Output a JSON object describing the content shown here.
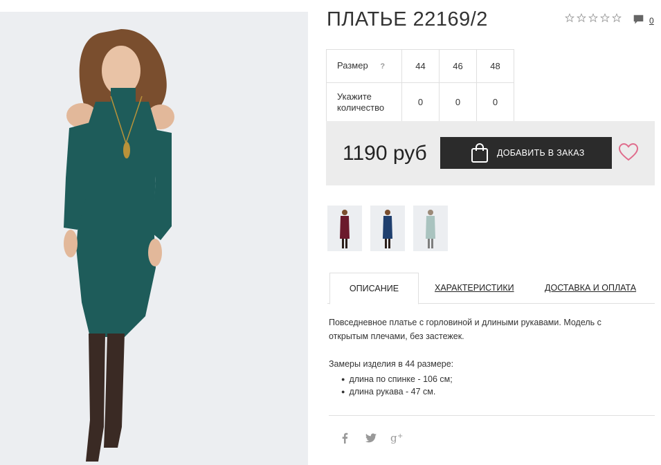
{
  "product": {
    "title": "ПЛАТЬЕ 22169/2",
    "rating_stars": 5,
    "rating_value": 0,
    "comments_count": "0"
  },
  "size_table": {
    "size_label": "Размер",
    "help": "?",
    "sizes": [
      "44",
      "46",
      "48"
    ],
    "qty_label": "Укажите количество",
    "quantities": [
      "0",
      "0",
      "0"
    ]
  },
  "buy": {
    "price": "1190 руб",
    "add_button": "ДОБАВИТЬ В ЗАКАЗ"
  },
  "thumbnails": [
    {
      "color": "burgundy"
    },
    {
      "color": "navy"
    },
    {
      "color": "light-teal"
    }
  ],
  "tabs": [
    {
      "label": "ОПИСАНИЕ",
      "active": true
    },
    {
      "label": "ХАРАКТЕРИСТИКИ",
      "active": false
    },
    {
      "label": "ДОСТАВКА И ОПЛАТА",
      "active": false
    }
  ],
  "description": {
    "text": "Повседневное платье с горловиной и длиными рукавами. Модель с открытым плечами, без застежек.",
    "measure_title": "Замеры изделия в 44 размере:",
    "measures": [
      "длина по спинке - 106 см;",
      "длина рукава - 47 см."
    ]
  },
  "social": [
    {
      "icon": "facebook-icon",
      "glyph": "f"
    },
    {
      "icon": "twitter-icon",
      "glyph": "🐦"
    },
    {
      "icon": "google-plus-icon",
      "glyph": "g+"
    }
  ],
  "colors": {
    "dress_main": "#1e5c5a",
    "button_bg": "#2b2b2b",
    "heart": "#e06c8c",
    "buybox_bg": "#ececec"
  }
}
